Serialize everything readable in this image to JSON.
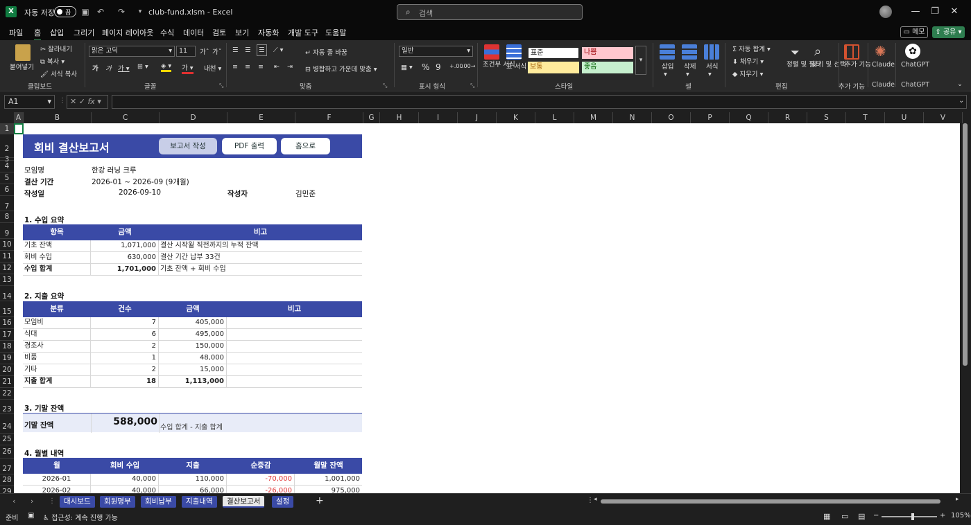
{
  "titlebar": {
    "autosave_label": "자동 저장",
    "autosave_state": "끔",
    "filename": "club-fund.xlsm",
    "app_sep": "-",
    "app_name": "Excel",
    "search_placeholder": "검색"
  },
  "menu": {
    "items": [
      "파일",
      "홈",
      "삽입",
      "그리기",
      "페이지 레이아웃",
      "수식",
      "데이터",
      "검토",
      "보기",
      "자동화",
      "개발 도구",
      "도움말"
    ],
    "active": "홈",
    "memo": "메모",
    "share": "공유"
  },
  "ribbon": {
    "clipboard": {
      "paste": "붙여넣기",
      "cut": "잘라내기",
      "copy": "복사",
      "format_painter": "서식 복사",
      "label": "클립보드"
    },
    "font": {
      "name": "맑은 고딕",
      "size": "11",
      "label": "글꼴"
    },
    "align": {
      "wrap": "자동 줄 바꿈",
      "merge": "병합하고 가운데 맞춤",
      "label": "맞춤"
    },
    "number": {
      "format": "일반",
      "label": "표시 형식"
    },
    "styles": {
      "cond": "조건부 서식",
      "table": "표 서식",
      "normal": "표준",
      "bad": "나쁨",
      "neutral": "보통",
      "good": "좋음",
      "label": "스타일"
    },
    "cells": {
      "insert": "삽입",
      "delete": "삭제",
      "format": "서식",
      "label": "셀"
    },
    "edit": {
      "autosum": "자동 합계",
      "fill": "채우기",
      "clear": "지우기",
      "sort": "정렬 및 필터",
      "find": "찾기 및 선택",
      "label": "편집"
    },
    "addins": {
      "label": "추가 기능",
      "btn": "추가 기능"
    },
    "claude": {
      "label": "Claude"
    },
    "chatgpt": {
      "label": "ChatGPT"
    }
  },
  "formula": {
    "namebox": "A1",
    "fx": "fx"
  },
  "columns": [
    "A",
    "B",
    "C",
    "D",
    "E",
    "F",
    "G",
    "H",
    "I",
    "J",
    "K",
    "L",
    "M",
    "N",
    "O",
    "P",
    "Q",
    "R",
    "S",
    "T",
    "U",
    "V"
  ],
  "rows": [
    "1",
    "2",
    "3",
    "4",
    "5",
    "6",
    "7",
    "8",
    "9",
    "10",
    "11",
    "12",
    "13",
    "14",
    "15",
    "16",
    "17",
    "18",
    "19",
    "20",
    "21",
    "22",
    "23",
    "24",
    "25",
    "26",
    "27",
    "28",
    "29"
  ],
  "report": {
    "title": "회비 결산보고서",
    "buttons": [
      "보고서 작성",
      "PDF 출력",
      "홈으로"
    ],
    "club_label": "모임명",
    "club_value": "한강 러닝 크루",
    "period_label": "결산 기간",
    "period_value": "2026-01 ~ 2026-09 (9개월)",
    "date_label": "작성일",
    "date_value": "2026-09-10",
    "author_label": "작성자",
    "author_value": "김민준",
    "income": {
      "title": "1. 수입 요약",
      "headers": [
        "항목",
        "금액",
        "비고"
      ],
      "rows": [
        [
          "기초 잔액",
          "1,071,000",
          "결산 시작월 직전까지의 누적 잔액"
        ],
        [
          "회비 수입",
          "630,000",
          "결산 기간 납부 33건"
        ]
      ],
      "total": [
        "수입 합계",
        "1,701,000",
        "기초 잔액 + 회비 수입"
      ]
    },
    "expense": {
      "title": "2. 지출 요약",
      "headers": [
        "분류",
        "건수",
        "금액",
        "비고"
      ],
      "rows": [
        [
          "모임비",
          "7",
          "405,000"
        ],
        [
          "식대",
          "6",
          "495,000"
        ],
        [
          "경조사",
          "2",
          "150,000"
        ],
        [
          "비품",
          "1",
          "48,000"
        ],
        [
          "기타",
          "2",
          "15,000"
        ]
      ],
      "total": [
        "지출 합계",
        "18",
        "1,113,000"
      ]
    },
    "balance": {
      "title": "3. 기말 잔액",
      "label": "기말 잔액",
      "value": "588,000",
      "note": "수입 합계 - 지출 합계"
    },
    "monthly": {
      "title": "4. 월별 내역",
      "headers": [
        "월",
        "회비 수입",
        "지출",
        "순증감",
        "월말 잔액"
      ],
      "rows": [
        [
          "2026-01",
          "40,000",
          "110,000",
          "-70,000",
          "1,001,000"
        ],
        [
          "2026-02",
          "40,000",
          "66,000",
          "-26,000",
          "975,000"
        ]
      ]
    }
  },
  "tabs": [
    "대시보드",
    "회원명부",
    "회비납부",
    "지출내역",
    "결산보고서",
    "설정"
  ],
  "active_tab": "결산보고서",
  "status": {
    "ready": "준비",
    "accessibility": "접근성: 계속 진행 가능",
    "zoom": "105%"
  }
}
